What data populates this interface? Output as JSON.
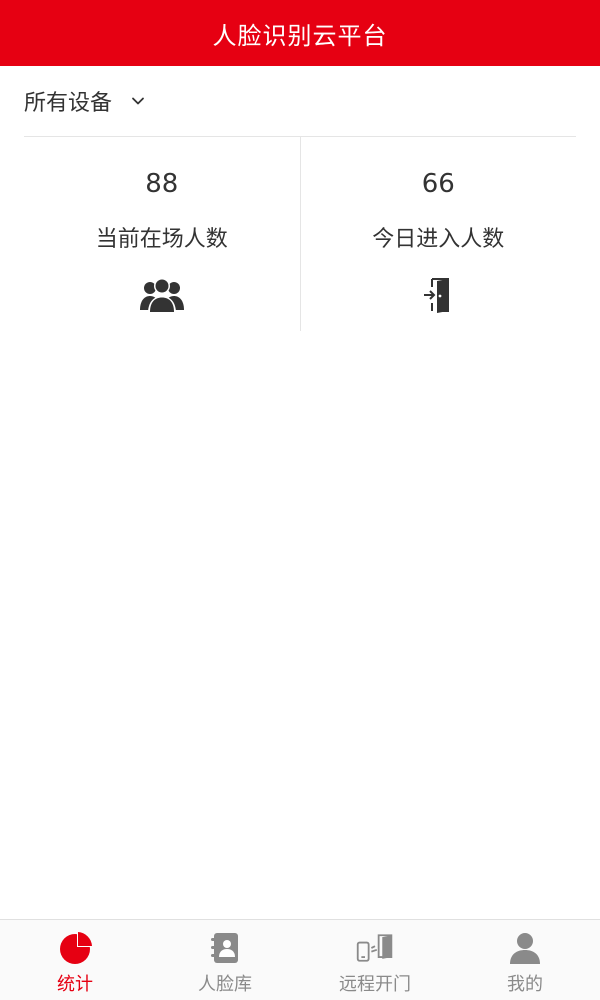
{
  "header": {
    "title": "人脸识别云平台"
  },
  "device_selector": {
    "selected": "所有设备",
    "icon": "chevron-down-icon"
  },
  "stats": [
    {
      "value": "88",
      "label": "当前在场人数",
      "icon": "people-group-icon"
    },
    {
      "value": "66",
      "label": "今日进入人数",
      "icon": "door-enter-icon"
    }
  ],
  "tabbar": {
    "items": [
      {
        "label": "统计",
        "icon": "pie-chart-icon",
        "active": true
      },
      {
        "label": "人脸库",
        "icon": "contacts-book-icon",
        "active": false
      },
      {
        "label": "远程开门",
        "icon": "remote-door-icon",
        "active": false
      },
      {
        "label": "我的",
        "icon": "user-icon",
        "active": false
      }
    ]
  },
  "colors": {
    "brand": "#e60012",
    "text": "#333333",
    "tab_inactive": "#8a8a8a",
    "divider": "#e5e5e5"
  }
}
